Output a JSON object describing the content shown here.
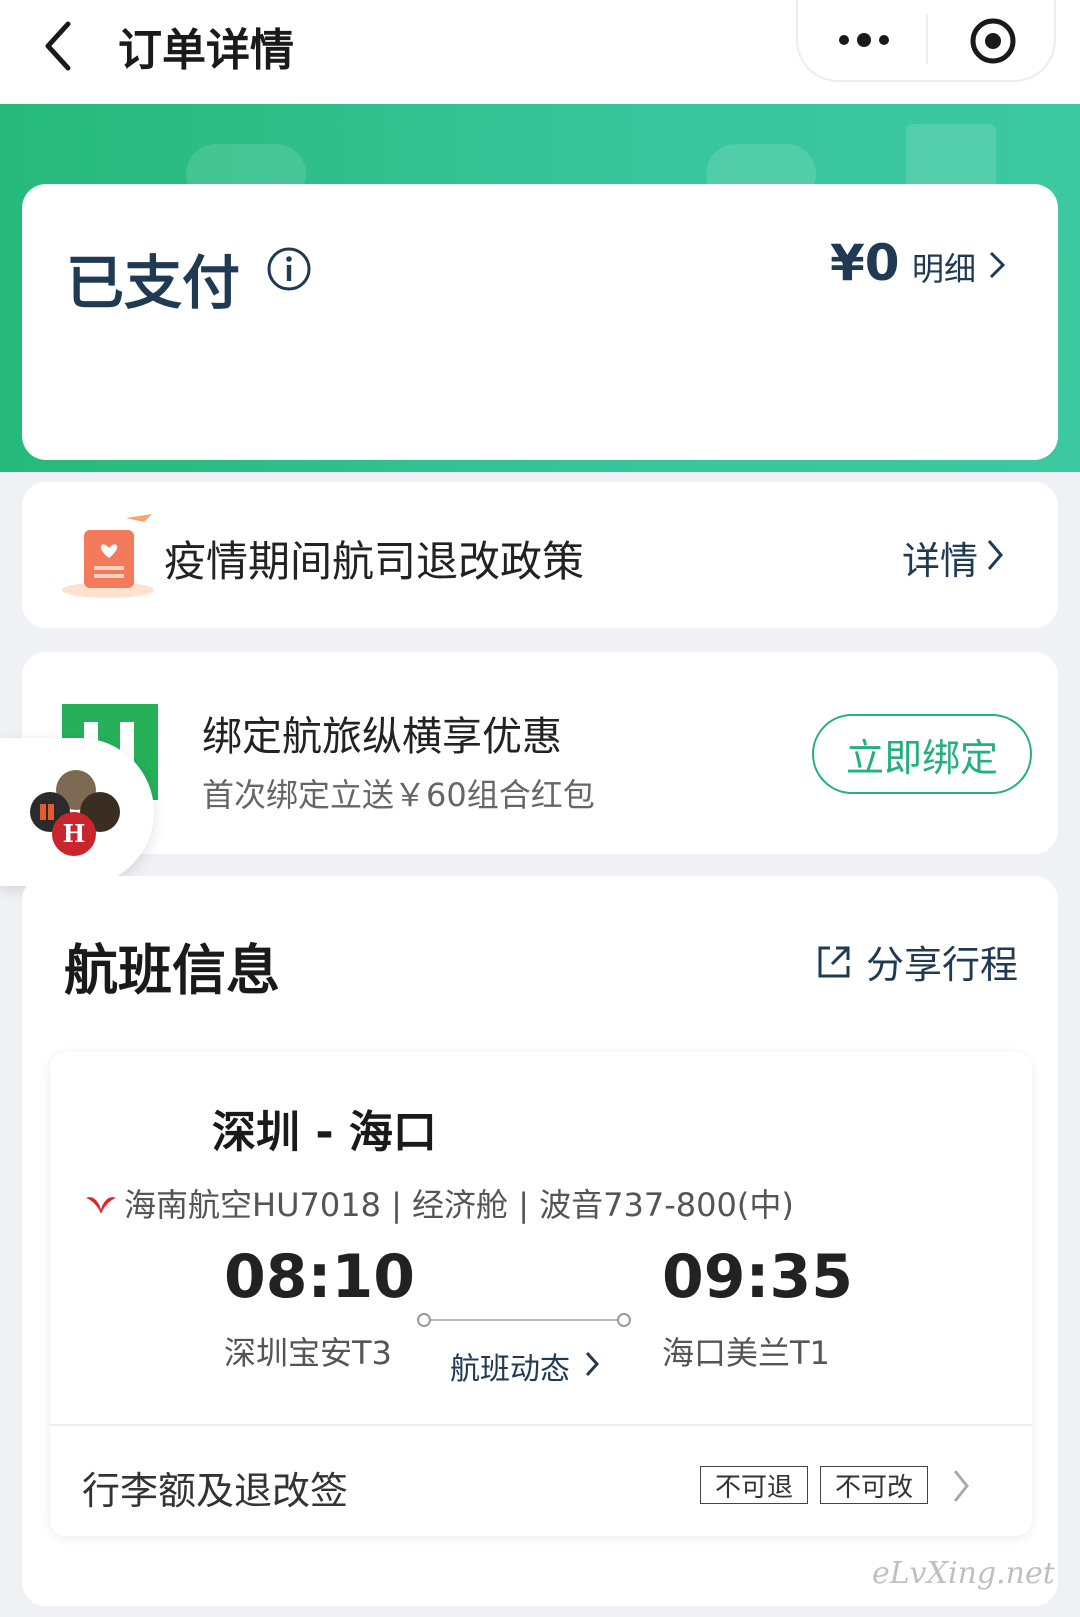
{
  "nav": {
    "title": "订单详情"
  },
  "payment": {
    "status": "已支付",
    "price": "¥0",
    "detail_label": "明细"
  },
  "policy": {
    "text": "疫情期间航司退改政策",
    "link": "详情"
  },
  "bind": {
    "title": "绑定航旅纵横享优惠",
    "subtitle": "首次绑定立送￥60组合红包",
    "button": "立即绑定"
  },
  "flight": {
    "heading": "航班信息",
    "share": "分享行程",
    "route": "深圳 - 海口",
    "airline_info": "海南航空HU7018 | 经济舱 | 波音737-800(中)",
    "depart_time": "08:10",
    "depart_terminal": "深圳宝安T3",
    "arrive_time": "09:35",
    "arrive_terminal": "海口美兰T1",
    "status_link": "航班动态",
    "baggage": "行李额及退改签",
    "tags": [
      "不可退",
      "不可改"
    ]
  },
  "watermark": "eLvXing.net",
  "colors": {
    "brand_green": "#26b97b",
    "navy": "#203a53"
  }
}
